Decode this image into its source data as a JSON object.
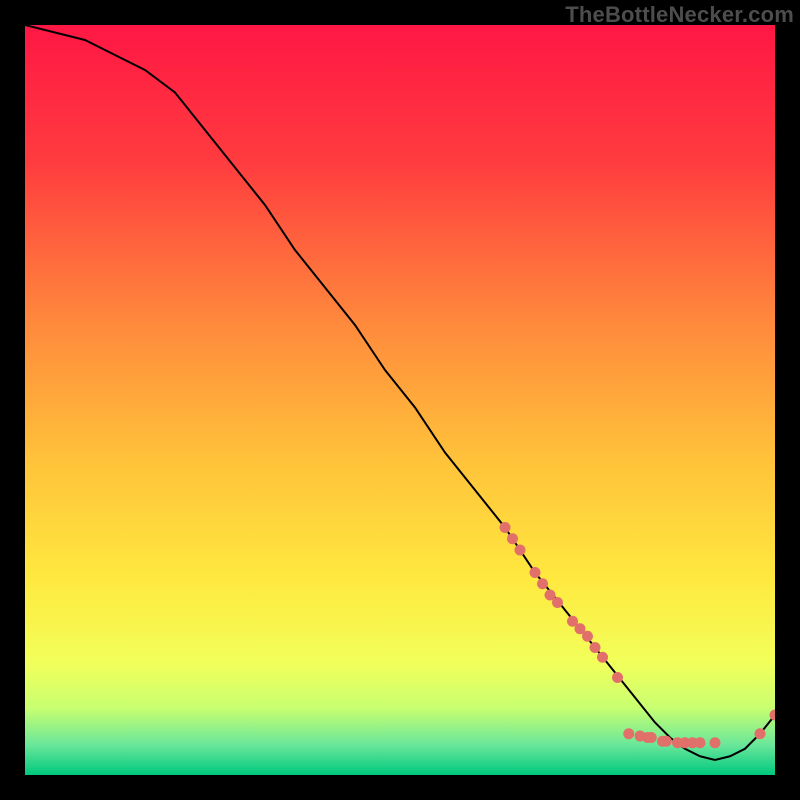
{
  "watermark": "TheBottleNecker.com",
  "chart_data": {
    "type": "line",
    "title": "",
    "xlabel": "",
    "ylabel": "",
    "xlim": [
      0,
      100
    ],
    "ylim": [
      0,
      100
    ],
    "background": "rainbow-gradient",
    "curve": {
      "name": "bottleneck-curve",
      "color": "#000000",
      "x": [
        0,
        4,
        8,
        12,
        16,
        20,
        24,
        28,
        32,
        36,
        40,
        44,
        48,
        52,
        56,
        60,
        64,
        68,
        72,
        76,
        80,
        82,
        84,
        86,
        88,
        90,
        92,
        94,
        96,
        98,
        100
      ],
      "y": [
        100,
        99,
        98,
        96,
        94,
        91,
        86,
        81,
        76,
        70,
        65,
        60,
        54,
        49,
        43,
        38,
        33,
        27,
        22,
        17,
        12,
        9.5,
        7.0,
        5.0,
        3.5,
        2.5,
        2.0,
        2.5,
        3.5,
        5.5,
        8.0
      ]
    },
    "highlight_points": {
      "name": "bottleneck-markers",
      "color": "#e2706a",
      "radius": 5.5,
      "points": [
        {
          "x": 64,
          "y": 33
        },
        {
          "x": 65,
          "y": 31.5
        },
        {
          "x": 66,
          "y": 30
        },
        {
          "x": 68,
          "y": 27
        },
        {
          "x": 69,
          "y": 25.5
        },
        {
          "x": 70,
          "y": 24
        },
        {
          "x": 71,
          "y": 23
        },
        {
          "x": 73,
          "y": 20.5
        },
        {
          "x": 74,
          "y": 19.5
        },
        {
          "x": 75,
          "y": 18.5
        },
        {
          "x": 76,
          "y": 17
        },
        {
          "x": 77,
          "y": 15.7
        },
        {
          "x": 79,
          "y": 13
        },
        {
          "x": 80.5,
          "y": 5.5
        },
        {
          "x": 82,
          "y": 5.2
        },
        {
          "x": 83,
          "y": 5.0
        },
        {
          "x": 83.5,
          "y": 5.0
        },
        {
          "x": 85,
          "y": 4.5
        },
        {
          "x": 85.5,
          "y": 4.5
        },
        {
          "x": 87,
          "y": 4.3
        },
        {
          "x": 88,
          "y": 4.3
        },
        {
          "x": 89,
          "y": 4.3
        },
        {
          "x": 90,
          "y": 4.3
        },
        {
          "x": 92,
          "y": 4.3
        },
        {
          "x": 98,
          "y": 5.5
        },
        {
          "x": 100,
          "y": 8.0
        }
      ]
    },
    "gradient_stops": [
      {
        "offset": 0.0,
        "color": "#ff1744"
      },
      {
        "offset": 0.18,
        "color": "#ff3b3f"
      },
      {
        "offset": 0.4,
        "color": "#ff8a3c"
      },
      {
        "offset": 0.58,
        "color": "#ffc23a"
      },
      {
        "offset": 0.74,
        "color": "#ffe93f"
      },
      {
        "offset": 0.85,
        "color": "#f2ff5a"
      },
      {
        "offset": 0.91,
        "color": "#c9ff70"
      },
      {
        "offset": 0.96,
        "color": "#69e79a"
      },
      {
        "offset": 1.0,
        "color": "#00c97e"
      }
    ]
  }
}
